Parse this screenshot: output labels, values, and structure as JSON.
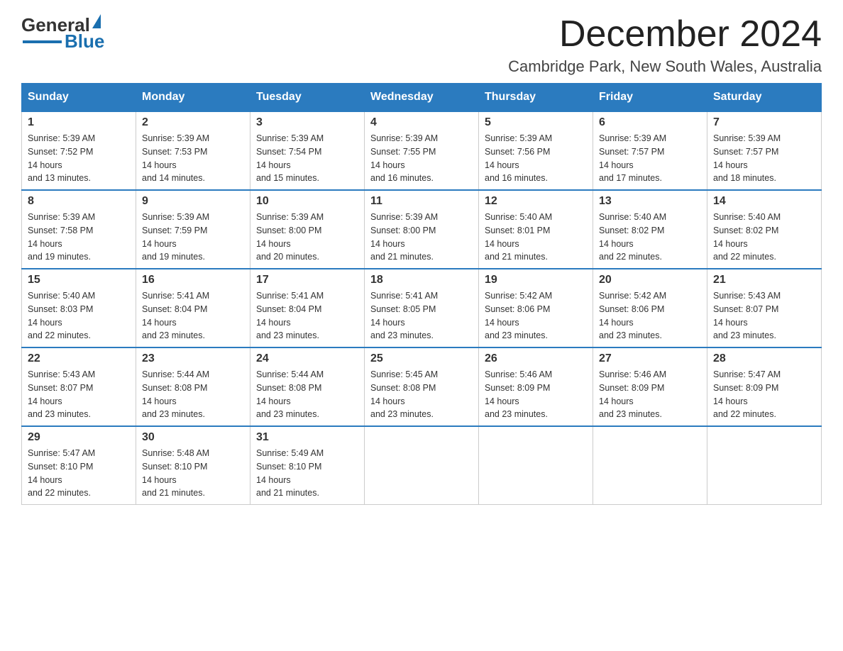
{
  "header": {
    "logo_general": "General",
    "logo_blue": "Blue",
    "month_title": "December 2024",
    "location": "Cambridge Park, New South Wales, Australia"
  },
  "days_of_week": [
    "Sunday",
    "Monday",
    "Tuesday",
    "Wednesday",
    "Thursday",
    "Friday",
    "Saturday"
  ],
  "weeks": [
    [
      {
        "day": "1",
        "sunrise": "Sunrise: 5:39 AM",
        "sunset": "Sunset: 7:52 PM",
        "daylight": "Daylight: 14 hours and 13 minutes."
      },
      {
        "day": "2",
        "sunrise": "Sunrise: 5:39 AM",
        "sunset": "Sunset: 7:53 PM",
        "daylight": "Daylight: 14 hours and 14 minutes."
      },
      {
        "day": "3",
        "sunrise": "Sunrise: 5:39 AM",
        "sunset": "Sunset: 7:54 PM",
        "daylight": "Daylight: 14 hours and 15 minutes."
      },
      {
        "day": "4",
        "sunrise": "Sunrise: 5:39 AM",
        "sunset": "Sunset: 7:55 PM",
        "daylight": "Daylight: 14 hours and 16 minutes."
      },
      {
        "day": "5",
        "sunrise": "Sunrise: 5:39 AM",
        "sunset": "Sunset: 7:56 PM",
        "daylight": "Daylight: 14 hours and 16 minutes."
      },
      {
        "day": "6",
        "sunrise": "Sunrise: 5:39 AM",
        "sunset": "Sunset: 7:57 PM",
        "daylight": "Daylight: 14 hours and 17 minutes."
      },
      {
        "day": "7",
        "sunrise": "Sunrise: 5:39 AM",
        "sunset": "Sunset: 7:57 PM",
        "daylight": "Daylight: 14 hours and 18 minutes."
      }
    ],
    [
      {
        "day": "8",
        "sunrise": "Sunrise: 5:39 AM",
        "sunset": "Sunset: 7:58 PM",
        "daylight": "Daylight: 14 hours and 19 minutes."
      },
      {
        "day": "9",
        "sunrise": "Sunrise: 5:39 AM",
        "sunset": "Sunset: 7:59 PM",
        "daylight": "Daylight: 14 hours and 19 minutes."
      },
      {
        "day": "10",
        "sunrise": "Sunrise: 5:39 AM",
        "sunset": "Sunset: 8:00 PM",
        "daylight": "Daylight: 14 hours and 20 minutes."
      },
      {
        "day": "11",
        "sunrise": "Sunrise: 5:39 AM",
        "sunset": "Sunset: 8:00 PM",
        "daylight": "Daylight: 14 hours and 21 minutes."
      },
      {
        "day": "12",
        "sunrise": "Sunrise: 5:40 AM",
        "sunset": "Sunset: 8:01 PM",
        "daylight": "Daylight: 14 hours and 21 minutes."
      },
      {
        "day": "13",
        "sunrise": "Sunrise: 5:40 AM",
        "sunset": "Sunset: 8:02 PM",
        "daylight": "Daylight: 14 hours and 22 minutes."
      },
      {
        "day": "14",
        "sunrise": "Sunrise: 5:40 AM",
        "sunset": "Sunset: 8:02 PM",
        "daylight": "Daylight: 14 hours and 22 minutes."
      }
    ],
    [
      {
        "day": "15",
        "sunrise": "Sunrise: 5:40 AM",
        "sunset": "Sunset: 8:03 PM",
        "daylight": "Daylight: 14 hours and 22 minutes."
      },
      {
        "day": "16",
        "sunrise": "Sunrise: 5:41 AM",
        "sunset": "Sunset: 8:04 PM",
        "daylight": "Daylight: 14 hours and 23 minutes."
      },
      {
        "day": "17",
        "sunrise": "Sunrise: 5:41 AM",
        "sunset": "Sunset: 8:04 PM",
        "daylight": "Daylight: 14 hours and 23 minutes."
      },
      {
        "day": "18",
        "sunrise": "Sunrise: 5:41 AM",
        "sunset": "Sunset: 8:05 PM",
        "daylight": "Daylight: 14 hours and 23 minutes."
      },
      {
        "day": "19",
        "sunrise": "Sunrise: 5:42 AM",
        "sunset": "Sunset: 8:06 PM",
        "daylight": "Daylight: 14 hours and 23 minutes."
      },
      {
        "day": "20",
        "sunrise": "Sunrise: 5:42 AM",
        "sunset": "Sunset: 8:06 PM",
        "daylight": "Daylight: 14 hours and 23 minutes."
      },
      {
        "day": "21",
        "sunrise": "Sunrise: 5:43 AM",
        "sunset": "Sunset: 8:07 PM",
        "daylight": "Daylight: 14 hours and 23 minutes."
      }
    ],
    [
      {
        "day": "22",
        "sunrise": "Sunrise: 5:43 AM",
        "sunset": "Sunset: 8:07 PM",
        "daylight": "Daylight: 14 hours and 23 minutes."
      },
      {
        "day": "23",
        "sunrise": "Sunrise: 5:44 AM",
        "sunset": "Sunset: 8:08 PM",
        "daylight": "Daylight: 14 hours and 23 minutes."
      },
      {
        "day": "24",
        "sunrise": "Sunrise: 5:44 AM",
        "sunset": "Sunset: 8:08 PM",
        "daylight": "Daylight: 14 hours and 23 minutes."
      },
      {
        "day": "25",
        "sunrise": "Sunrise: 5:45 AM",
        "sunset": "Sunset: 8:08 PM",
        "daylight": "Daylight: 14 hours and 23 minutes."
      },
      {
        "day": "26",
        "sunrise": "Sunrise: 5:46 AM",
        "sunset": "Sunset: 8:09 PM",
        "daylight": "Daylight: 14 hours and 23 minutes."
      },
      {
        "day": "27",
        "sunrise": "Sunrise: 5:46 AM",
        "sunset": "Sunset: 8:09 PM",
        "daylight": "Daylight: 14 hours and 23 minutes."
      },
      {
        "day": "28",
        "sunrise": "Sunrise: 5:47 AM",
        "sunset": "Sunset: 8:09 PM",
        "daylight": "Daylight: 14 hours and 22 minutes."
      }
    ],
    [
      {
        "day": "29",
        "sunrise": "Sunrise: 5:47 AM",
        "sunset": "Sunset: 8:10 PM",
        "daylight": "Daylight: 14 hours and 22 minutes."
      },
      {
        "day": "30",
        "sunrise": "Sunrise: 5:48 AM",
        "sunset": "Sunset: 8:10 PM",
        "daylight": "Daylight: 14 hours and 21 minutes."
      },
      {
        "day": "31",
        "sunrise": "Sunrise: 5:49 AM",
        "sunset": "Sunset: 8:10 PM",
        "daylight": "Daylight: 14 hours and 21 minutes."
      },
      null,
      null,
      null,
      null
    ]
  ]
}
